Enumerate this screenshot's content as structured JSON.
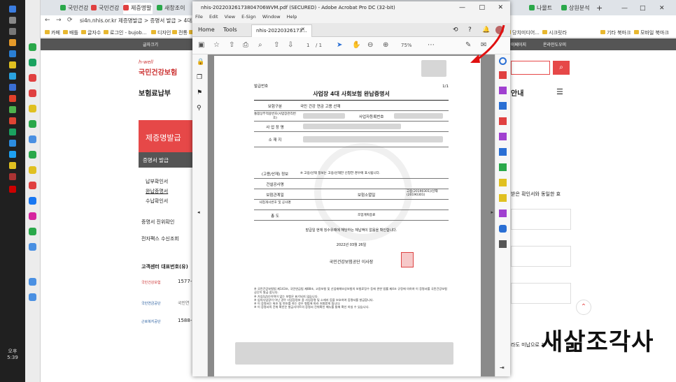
{
  "taskbar": {
    "time": "오후 5:39"
  },
  "browser": {
    "tabs": [
      "국민건강",
      "국민건강",
      "제증명발",
      "새창조이",
      "나몰트",
      "상원분석"
    ],
    "url": "si4n.nhis.or.kr  제증명발급 > 증명서 발급 > 4대보",
    "bookmarks": [
      "카페",
      "배틀",
      "글자수",
      "로그인 - bujob...",
      "디자인",
      "전통",
      "기타"
    ],
    "bookmarks_right": [
      "당치미디어...",
      "시크릿라",
      "기타 북마크",
      "모바일 북마크"
    ]
  },
  "site": {
    "topbar": [
      "글자크기",
      "이페이지",
      "온라인도우미"
    ],
    "logo_small": "h-well",
    "logo": "국민건강보험",
    "section": "보험료납부",
    "cert_banner": "제증명발급",
    "menu_head": "증명서 발급",
    "menu": [
      "납부확인서",
      "완납증명서",
      "수납확인서"
    ],
    "menu2": [
      "증명서 진위확인",
      "전자팩스 수신조회"
    ],
    "cs_title": "고객센터 대표번호(유)",
    "cs_rows": [
      {
        "name": "국민건강보험",
        "num": "1577-"
      },
      {
        "name": "국민연금공단",
        "num": "국민연"
      },
      {
        "name": "근로복지공단",
        "num": "1588-"
      }
    ],
    "right_heading": "안내",
    "right_text": "받은 확인서와 동일한 효",
    "right_bottom": "라도 미납으로 표",
    "signature": "새삶조각사"
  },
  "acrobat": {
    "title": "nhis-20220326173804706WVM.pdf (SECURED) - Adobe Acrobat Pro DC (32-bit)",
    "menu": [
      "File",
      "Edit",
      "View",
      "E-Sign",
      "Window",
      "Help"
    ],
    "tabs": [
      "Home",
      "Tools"
    ],
    "doc_tab": "nhis-20220326173...",
    "page_num": "1",
    "page_total": "/ 1",
    "zoom": "75%",
    "doc": {
      "issue_no_label": "발급번호",
      "page": "1/1",
      "title": "사업장 4대 사회보험 완납증명서",
      "rows": [
        {
          "label": "보험구분",
          "value": "국민 건강 연금 고용 산재"
        },
        {
          "label": "통합상부적용번호(사업장관리번호)",
          "value": "사업자등록번호"
        },
        {
          "label": "사 업 장 명",
          "value": ""
        },
        {
          "label": "소 재 지",
          "value": ""
        }
      ],
      "rows2": [
        {
          "label": "(고용/산재) 정보",
          "value": "※ 고용/산재 정보는 고용/산재만 신청한 경우에 표시됩니다."
        },
        {
          "label": "건설공사명",
          "value": ""
        },
        {
          "label": "보험관계일",
          "value": "보험소멸일",
          "extra": "고용(20190301)/산재(20190301)"
        },
        {
          "label": "사업개시번호 및 공사명",
          "value": ""
        },
        {
          "label": "총          도",
          "value": "조업계획종료"
        }
      ],
      "purpose": "발급일 현재 징수유예에 해당하는 체납액이 없음을 확인합니다.",
      "date": "2022년 03월 26일",
      "issuer": "국민건강보험공단 이사장",
      "notes": [
        "※ 국민건강보험법 제143조, 국민연금법 제88조, 고용보험 및 산업재해보상보험의 보험료징수 등에 관한 법률 제4조 규정에 의하여 이 증명서를 국민건강보험공단이 발급 합니다.",
        "※ 가입(납부)이력이 없는 보험은 표기되지 않습니다.",
        "※ 임의사업장이 아닌 경우 사업장정보 중 사업장명 및 소재지 등을 보호하여 증명서를 발급합니다.",
        "※ 이 증명서는 위조 및 변조를 하는 경우 형법에 따라 처벌받게 됩니다.",
        "※ 이 증명서의 진위 확인은 발급사이트의 증명서 진위확인 메뉴를 통해 확인 하실 수 있습니다."
      ]
    }
  }
}
